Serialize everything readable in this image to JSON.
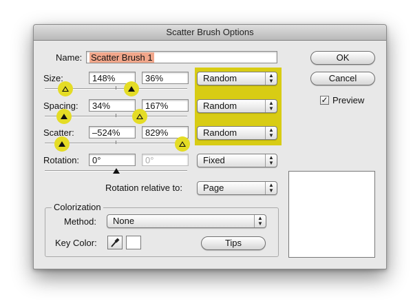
{
  "dialog": {
    "title": "Scatter Brush Options"
  },
  "name": {
    "label": "Name:",
    "value": "Scatter Brush 1"
  },
  "buttons": {
    "ok": "OK",
    "cancel": "Cancel",
    "tips": "Tips"
  },
  "preview": {
    "label": "Preview",
    "checked": true,
    "check_glyph": "✓"
  },
  "rows": {
    "size": {
      "label": "Size:",
      "min": "148%",
      "max": "36%",
      "mode": "Random"
    },
    "spacing": {
      "label": "Spacing:",
      "min": "34%",
      "max": "167%",
      "mode": "Random"
    },
    "scatter": {
      "label": "Scatter:",
      "min": "–524%",
      "max": "829%",
      "mode": "Random"
    },
    "rotation": {
      "label": "Rotation:",
      "min": "0°",
      "max": "0°",
      "mode": "Fixed"
    }
  },
  "rotation_relative": {
    "label": "Rotation relative to:",
    "value": "Page"
  },
  "colorization": {
    "title": "Colorization",
    "method_label": "Method:",
    "method_value": "None",
    "key_color_label": "Key Color:",
    "key_color": "#ffffff"
  },
  "colors": {
    "highlight": "#d8cc14",
    "slider_marker_highlight": "#e4dc25",
    "name_selection": "#f2a78b"
  },
  "icons": {
    "popup_arrows": "up-down-arrows-icon",
    "eyedropper": "eyedropper-icon"
  }
}
